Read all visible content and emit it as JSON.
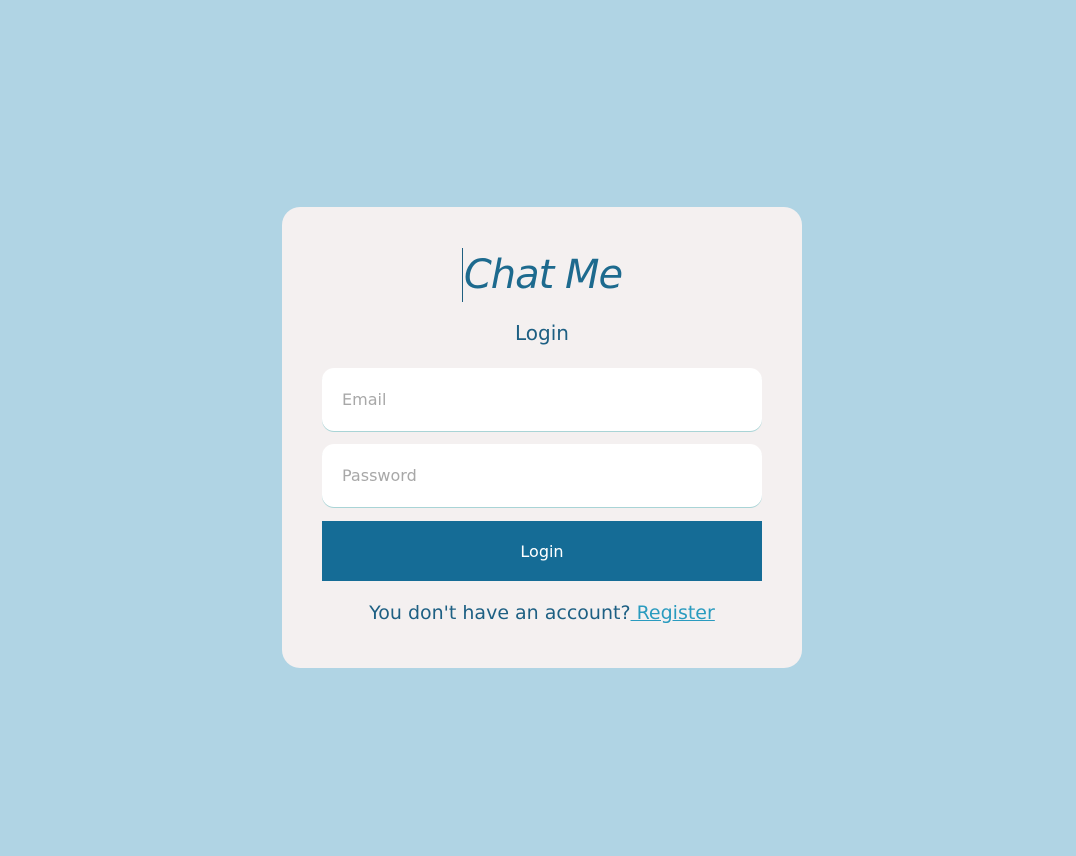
{
  "brand": {
    "title": "Chat Me"
  },
  "form": {
    "heading": "Login",
    "email_placeholder": "Email",
    "password_placeholder": "Password",
    "submit_label": "Login"
  },
  "footer": {
    "prompt": "You don't have an account?",
    "link_label": " Register"
  },
  "colors": {
    "background": "#b0d4e4",
    "card": "#f4f0f0",
    "primary": "#156c96",
    "link": "#2a9bbf",
    "text": "#1d5f83"
  }
}
